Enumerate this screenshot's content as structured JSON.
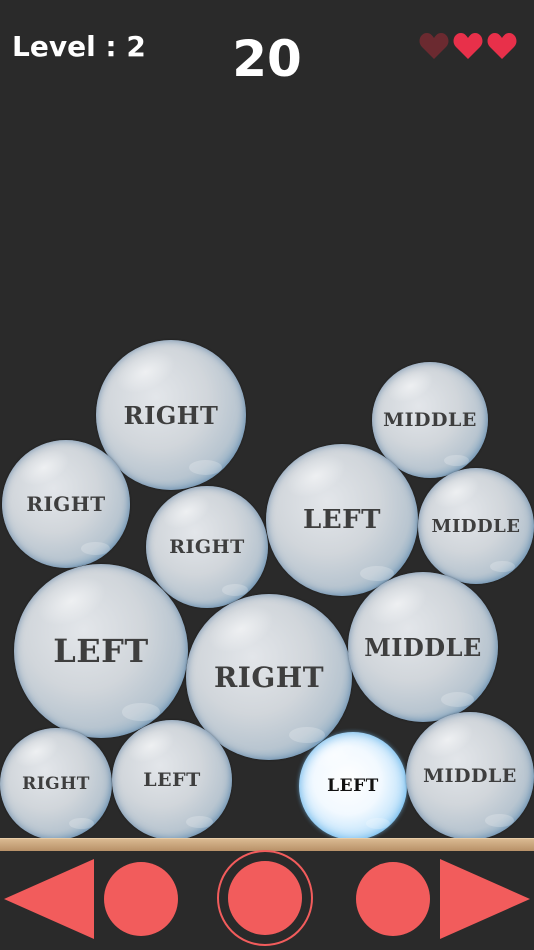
{
  "hud": {
    "level_label": "Level : 2",
    "score": "20",
    "lives": {
      "total": 3,
      "remaining": 2
    },
    "heart_full_color": "#e8304a",
    "heart_lost_color": "#6b2a30"
  },
  "bubbles": [
    {
      "label": "RIGHT"
    },
    {
      "label": "MIDDLE"
    },
    {
      "label": "RIGHT"
    },
    {
      "label": "RIGHT"
    },
    {
      "label": "LEFT"
    },
    {
      "label": "MIDDLE"
    },
    {
      "label": "LEFT"
    },
    {
      "label": "RIGHT"
    },
    {
      "label": "MIDDLE"
    },
    {
      "label": "RIGHT"
    },
    {
      "label": "LEFT"
    },
    {
      "label": "LEFT"
    },
    {
      "label": "MIDDLE"
    }
  ],
  "controls": {
    "left_arrow": "left-arrow-icon",
    "left_dot": "left-circle-button",
    "middle": "middle-circle-button",
    "right_dot": "right-circle-button",
    "right_arrow": "right-arrow-icon",
    "accent_color": "#f25c5c"
  }
}
